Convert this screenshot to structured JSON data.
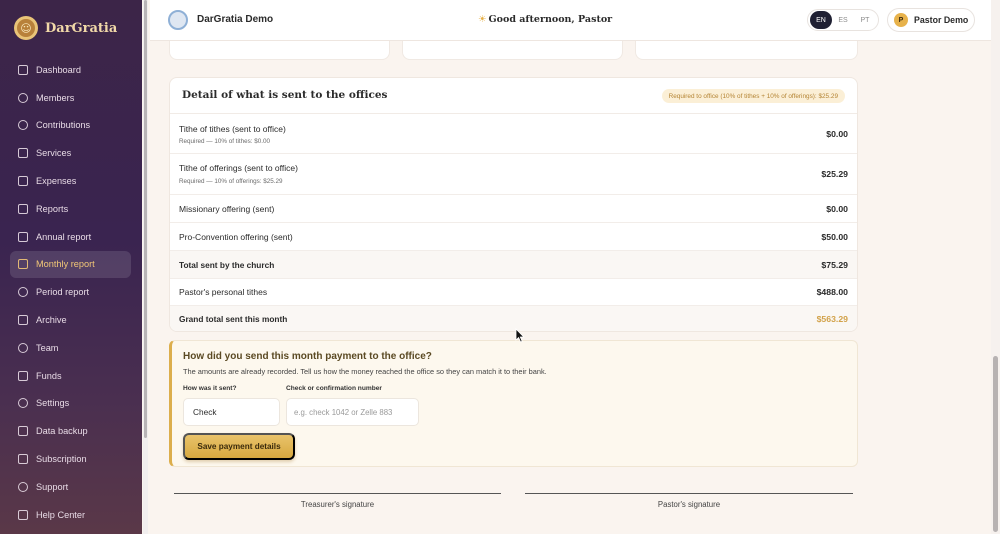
{
  "app": {
    "brand": "DarGratia"
  },
  "sidebar": {
    "items": [
      {
        "label": "Dashboard",
        "icon": "grid-icon"
      },
      {
        "label": "Members",
        "icon": "users-icon"
      },
      {
        "label": "Contributions",
        "icon": "dollar-icon"
      },
      {
        "label": "Services",
        "icon": "church-icon"
      },
      {
        "label": "Expenses",
        "icon": "wallet-icon"
      },
      {
        "label": "Reports",
        "icon": "bar-chart-icon"
      },
      {
        "label": "Annual report",
        "icon": "calendar-icon"
      },
      {
        "label": "Monthly report",
        "icon": "document-icon",
        "active": true
      },
      {
        "label": "Period report",
        "icon": "clock-icon"
      },
      {
        "label": "Archive",
        "icon": "archive-icon"
      },
      {
        "label": "Team",
        "icon": "user-icon"
      },
      {
        "label": "Funds",
        "icon": "piggy-bank-icon"
      },
      {
        "label": "Settings",
        "icon": "gear-icon"
      },
      {
        "label": "Data backup",
        "icon": "folder-icon"
      },
      {
        "label": "Subscription",
        "icon": "card-icon"
      },
      {
        "label": "Support",
        "icon": "help-icon"
      },
      {
        "label": "Help Center",
        "icon": "book-icon"
      }
    ]
  },
  "header": {
    "church_name": "DarGratia Demo",
    "greeting": "Good afternoon, Pastor",
    "languages": [
      "EN",
      "ES",
      "PT"
    ],
    "active_language": "EN",
    "user_initial": "P",
    "user_name": "Pastor Demo"
  },
  "detail": {
    "title": "Detail of what is sent to the offices",
    "badge": "Required to office (10% of tithes + 10% of offerings): $25.29",
    "rows": [
      {
        "label": "Tithe of tithes (sent to office)",
        "sub": "Required — 10% of tithes: $0.00",
        "amount": "$0.00"
      },
      {
        "label": "Tithe of offerings (sent to office)",
        "sub": "Required — 10% of offerings: $25.29",
        "amount": "$25.29"
      },
      {
        "label": "Missionary offering (sent)",
        "amount": "$0.00"
      },
      {
        "label": "Pro-Convention offering (sent)",
        "amount": "$50.00"
      },
      {
        "label": "Total sent by the church",
        "amount": "$75.29"
      },
      {
        "label": "Pastor's personal tithes",
        "amount": "$488.00"
      },
      {
        "label": "Grand total sent this month",
        "amount": "$563.29"
      }
    ]
  },
  "payment": {
    "title": "How did you send this month payment to the office?",
    "description": "The amounts are already recorded. Tell us how the money reached the office so they can match it to their bank.",
    "method_label": "How was it sent?",
    "method_value": "Check",
    "confirmation_label": "Check or confirmation number",
    "confirmation_placeholder": "e.g. check 1042 or Zelle 883",
    "save_label": "Save payment details"
  },
  "signatures": {
    "treasurer": "Treasurer's signature",
    "pastor": "Pastor's signature"
  },
  "colors": {
    "sidebar": "#3a2450",
    "accent_gold": "#d7a83f",
    "active_nav": "#f2c777"
  }
}
